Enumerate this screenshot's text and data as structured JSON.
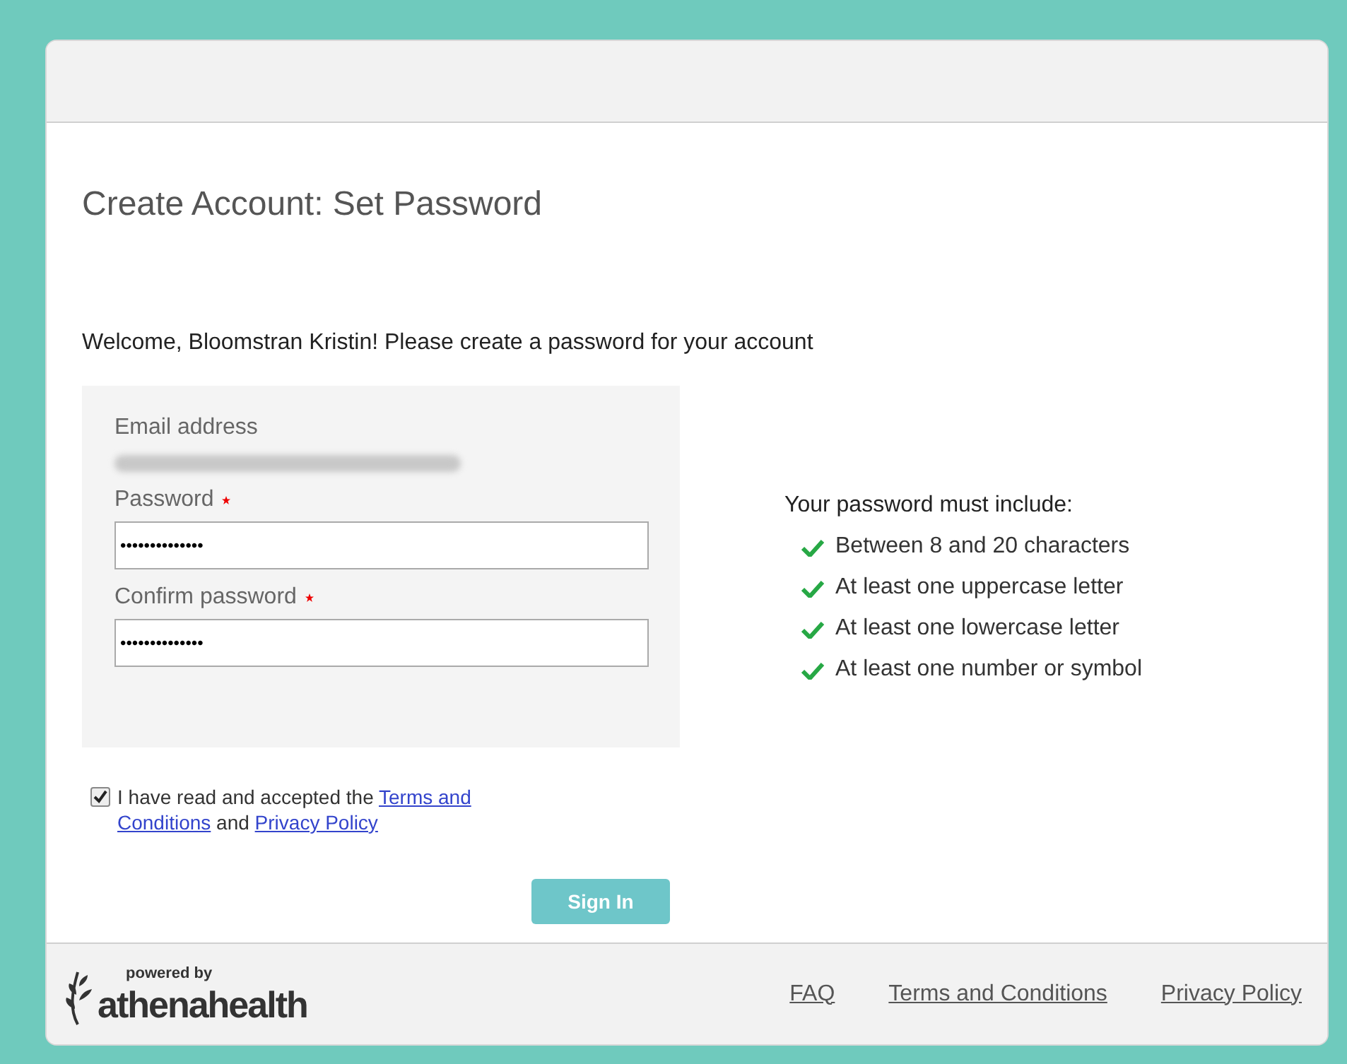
{
  "title": "Create Account: Set Password",
  "welcome": "Welcome, Bloomstran Kristin! Please create a password for your account",
  "form": {
    "email_label": "Email address",
    "fields": [
      {
        "label": "Password",
        "required": true,
        "value": "••••••••••••••"
      },
      {
        "label": "Confirm password",
        "required": true,
        "value": "••••••••••••••"
      }
    ]
  },
  "requirements": {
    "heading": "Your password must include:",
    "items": [
      {
        "text": "Between 8 and 20 characters",
        "met": true
      },
      {
        "text": "At least one uppercase letter",
        "met": true
      },
      {
        "text": "At least one lowercase letter",
        "met": true
      },
      {
        "text": "At least one number or symbol",
        "met": true
      }
    ]
  },
  "agreement": {
    "checked": true,
    "text_before": "I have read and accepted the",
    "link_1": [
      "Terms and",
      "Conditions"
    ],
    "text_middle": "and",
    "link_2": "Privacy Policy"
  },
  "button": "Sign In",
  "footer": {
    "powered_by": "powered by",
    "brand": "athenahealth",
    "links": [
      "FAQ",
      "Terms and Conditions",
      "Privacy Policy"
    ]
  }
}
